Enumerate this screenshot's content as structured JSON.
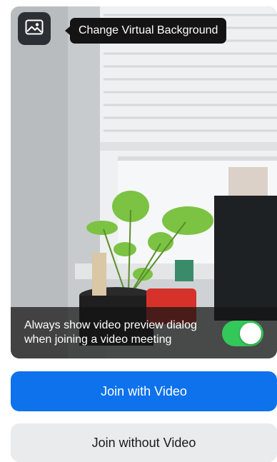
{
  "preview": {
    "virtual_background_icon": "image-icon",
    "tooltip_label": "Change Virtual Background",
    "always_show_line1": "Always show video preview dialog",
    "always_show_line2": "when joining a video meeting",
    "toggle_on": true
  },
  "actions": {
    "join_with_video": "Join with Video",
    "join_without_video": "Join without Video"
  },
  "colors": {
    "primary": "#0e72ed",
    "toggle_on": "#34c759",
    "secondary_bg": "#eaebed"
  }
}
